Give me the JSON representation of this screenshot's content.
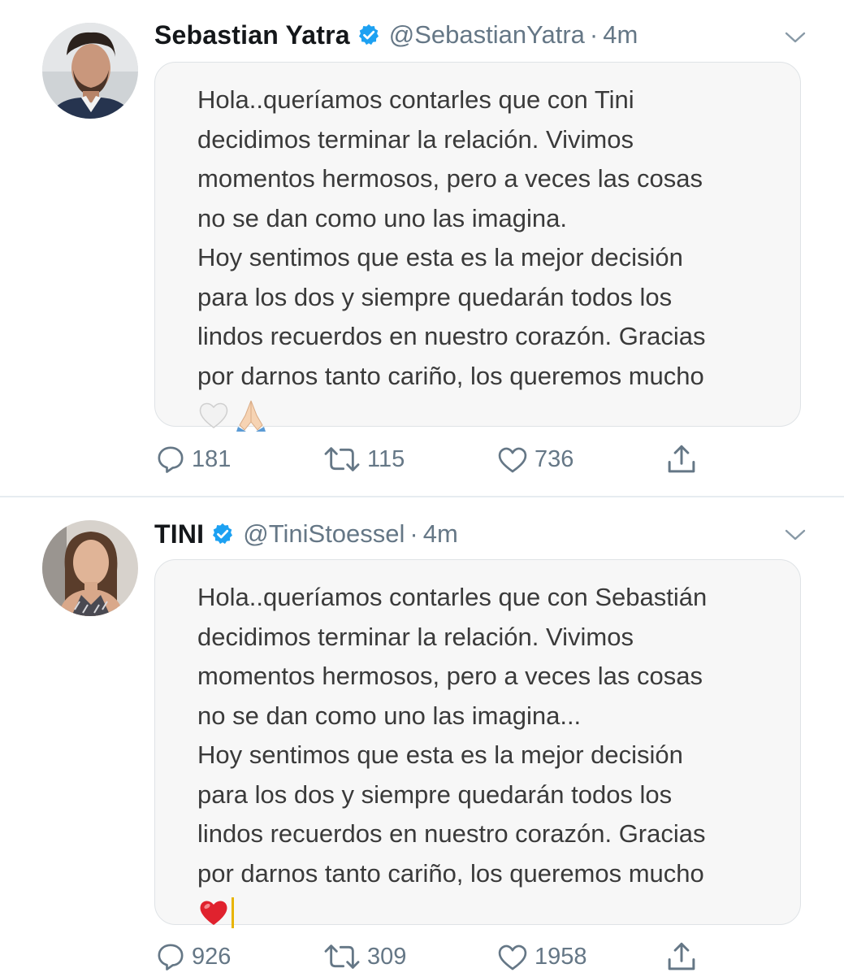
{
  "tweets": [
    {
      "display_name": "Sebastian Yatra",
      "handle": "@SebastianYatra",
      "separator": "·",
      "time": "4m",
      "avatar_icon": "avatar-photo",
      "verified_icon": "verified-badge-icon",
      "text_lines": [
        "Hola..queríamos contarles que con Tini",
        "decidimos terminar la relación. Vivimos",
        "momentos hermosos, pero a veces las cosas",
        "no se dan como uno las imagina.",
        "Hoy sentimos que esta es la mejor decisión",
        "para los dos y siempre quedarán todos los",
        "lindos recuerdos en nuestro corazón. Gracias",
        "por darnos tanto cariño, los queremos mucho"
      ],
      "emojis": [
        "white-heart-emoji",
        "folded-hands-emoji"
      ],
      "replies": "181",
      "retweets": "115",
      "likes": "736"
    },
    {
      "display_name": "TINI",
      "handle": "@TiniStoessel",
      "separator": "·",
      "time": "4m",
      "avatar_icon": "avatar-photo",
      "verified_icon": "verified-badge-icon",
      "text_lines": [
        "Hola..queríamos contarles que con Sebastián",
        "decidimos terminar la relación. Vivimos",
        "momentos hermosos, pero a veces las cosas",
        "no se dan como uno las imagina...",
        "Hoy sentimos que esta es la mejor decisión",
        "para los dos y siempre quedarán todos los",
        "lindos recuerdos en nuestro corazón. Gracias",
        "por darnos tanto cariño, los queremos mucho"
      ],
      "emojis": [
        "red-heart-emoji"
      ],
      "replies": "926",
      "retweets": "309",
      "likes": "1958"
    }
  ],
  "colors": {
    "verified_blue": "#1da1f2",
    "secondary_text": "#657786",
    "card_background": "#f7f7f7",
    "divider": "#e6ecf0"
  }
}
